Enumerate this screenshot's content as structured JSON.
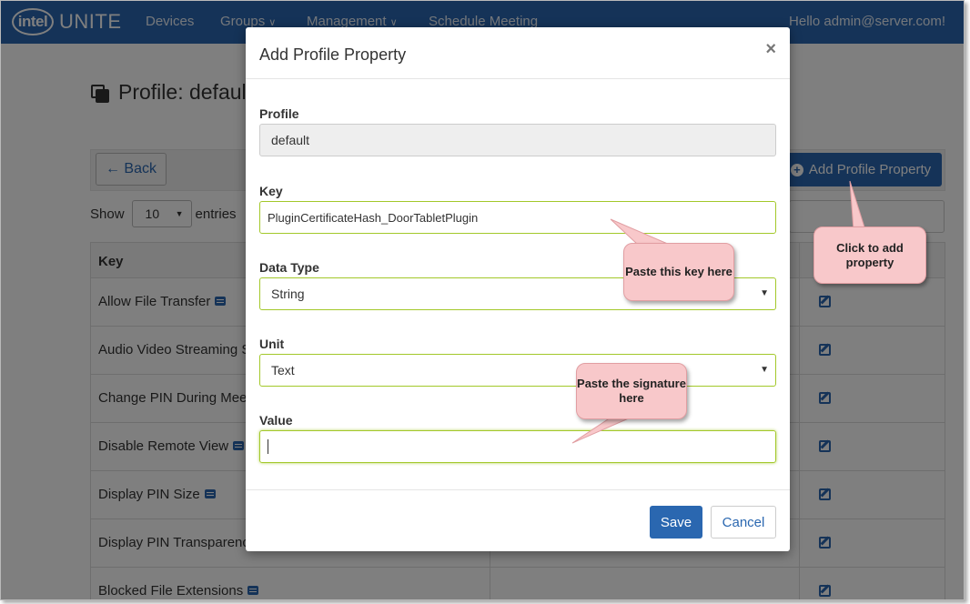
{
  "app": {
    "brand_intel": "intel",
    "brand_product": "UNITE"
  },
  "nav": {
    "items": [
      {
        "label": "Devices",
        "has_dropdown": false
      },
      {
        "label": "Groups",
        "has_dropdown": true
      },
      {
        "label": "Management",
        "has_dropdown": true
      },
      {
        "label": "Schedule Meeting",
        "has_dropdown": false
      }
    ],
    "user_greeting": "Hello admin@server.com!"
  },
  "page": {
    "title": "Profile: default",
    "back_label": "← Back",
    "add_property_label": "Add Profile Property",
    "show_label": "Show",
    "entries_value": "10",
    "entries_label": "entries",
    "table": {
      "header_key": "Key",
      "rows": [
        {
          "key": "Allow File Transfer"
        },
        {
          "key": "Audio Video Streaming S"
        },
        {
          "key": "Change PIN During Meet"
        },
        {
          "key": "Disable Remote View"
        },
        {
          "key": "Display PIN Size"
        },
        {
          "key": "Display PIN Transparenc"
        },
        {
          "key": "Blocked File Extensions"
        }
      ]
    }
  },
  "modal": {
    "title": "Add Profile Property",
    "close_glyph": "×",
    "fields": {
      "profile_label": "Profile",
      "profile_value": "default",
      "key_label": "Key",
      "key_value": "PluginCertificateHash_DoorTabletPlugin",
      "data_type_label": "Data Type",
      "data_type_value": "String",
      "unit_label": "Unit",
      "unit_value": "Text",
      "value_label": "Value",
      "value_value": ""
    },
    "save_label": "Save",
    "cancel_label": "Cancel"
  },
  "callouts": {
    "paste_key": "Paste this key here",
    "paste_signature": "Paste the signature here",
    "click_add": "Click to add property"
  },
  "colors": {
    "brand_blue": "#2a67b0",
    "field_border_green": "#a3c82a",
    "callout_pink": "#f8c8ca"
  }
}
